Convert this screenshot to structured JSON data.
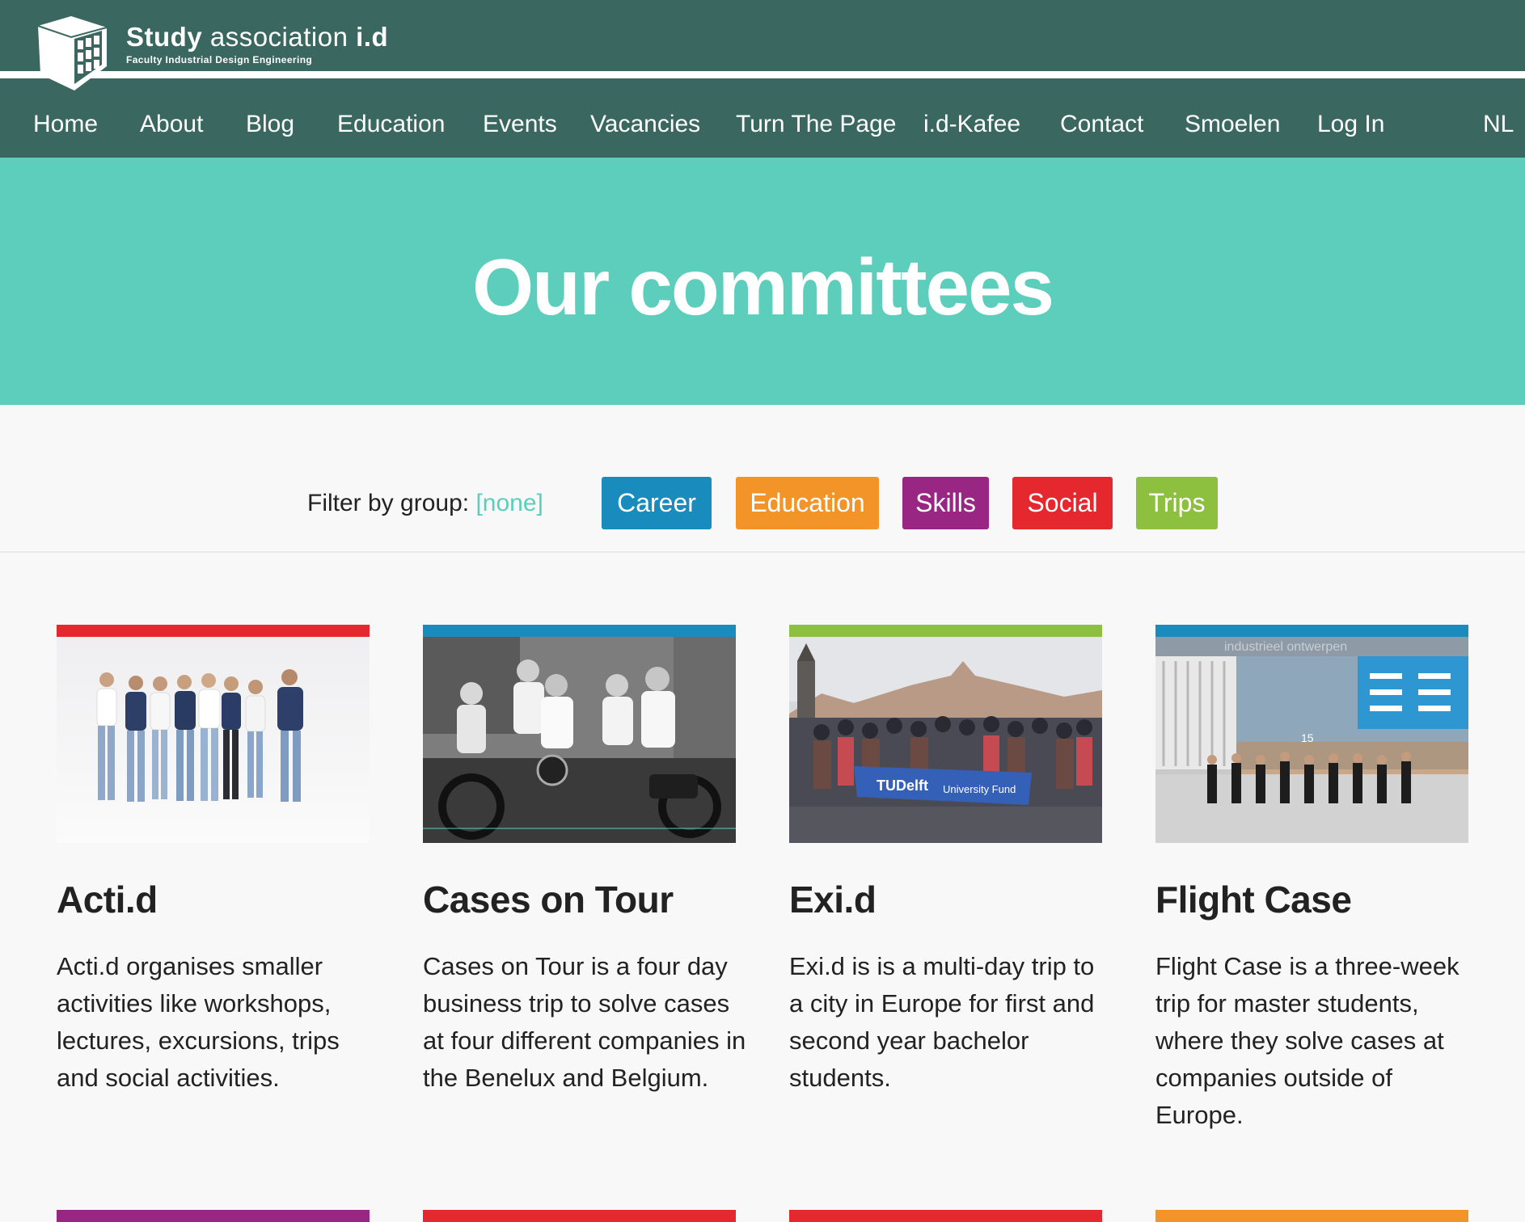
{
  "brand": {
    "name_bold": "Study",
    "name_rest": "association",
    "name_tag": "i.d",
    "subtitle": "Faculty Industrial Design Engineering",
    "logo_icon": "cube-grid-logo"
  },
  "nav": {
    "items": [
      "Home",
      "About",
      "Blog",
      "Education",
      "Events",
      "Vacancies",
      "Turn The Page",
      "i.d-Kafee",
      "Contact",
      "Smoelen",
      "Log In"
    ],
    "language": "NL"
  },
  "hero": {
    "title": "Our committees"
  },
  "filter": {
    "label": "Filter by group:",
    "none_label": "[none]",
    "groups": [
      {
        "label": "Career",
        "color": "#1a8bbd"
      },
      {
        "label": "Education",
        "color": "#f39428"
      },
      {
        "label": "Skills",
        "color": "#992683"
      },
      {
        "label": "Social",
        "color": "#e4282e"
      },
      {
        "label": "Trips",
        "color": "#8dc03f"
      }
    ]
  },
  "committees": [
    {
      "title": "Acti.d",
      "description": "Acti.d organises smaller activities like workshops, lectures, excursions, trips and social activities.",
      "group_color": "#e4282e",
      "photo": "group-photo"
    },
    {
      "title": "Cases on Tour",
      "description": "Cases on Tour is a four day business trip to solve cases at four different companies in the Benelux and Belgium.",
      "group_color": "#1a8bbd",
      "photo": "motorbike-photo"
    },
    {
      "title": "Exi.d",
      "description": "Exi.d is is a multi-day trip to a city in Europe for first and second year bachelor students.",
      "group_color": "#8dc03f",
      "photo": "prague-group-photo"
    },
    {
      "title": "Flight Case",
      "description": "Flight Case is a three-week trip for master students, where they solve cases at companies outside of Europe.",
      "group_color": "#1a8bbd",
      "photo": "building-group-photo"
    }
  ],
  "next_row_colors": [
    "#992683",
    "#e4282e",
    "#e4282e",
    "#f39428"
  ],
  "photo_text": {
    "banner_left": "TUDelft",
    "banner_right": "University Fund",
    "building_sign": "industrieel ontwerpen",
    "building_number": "15"
  }
}
